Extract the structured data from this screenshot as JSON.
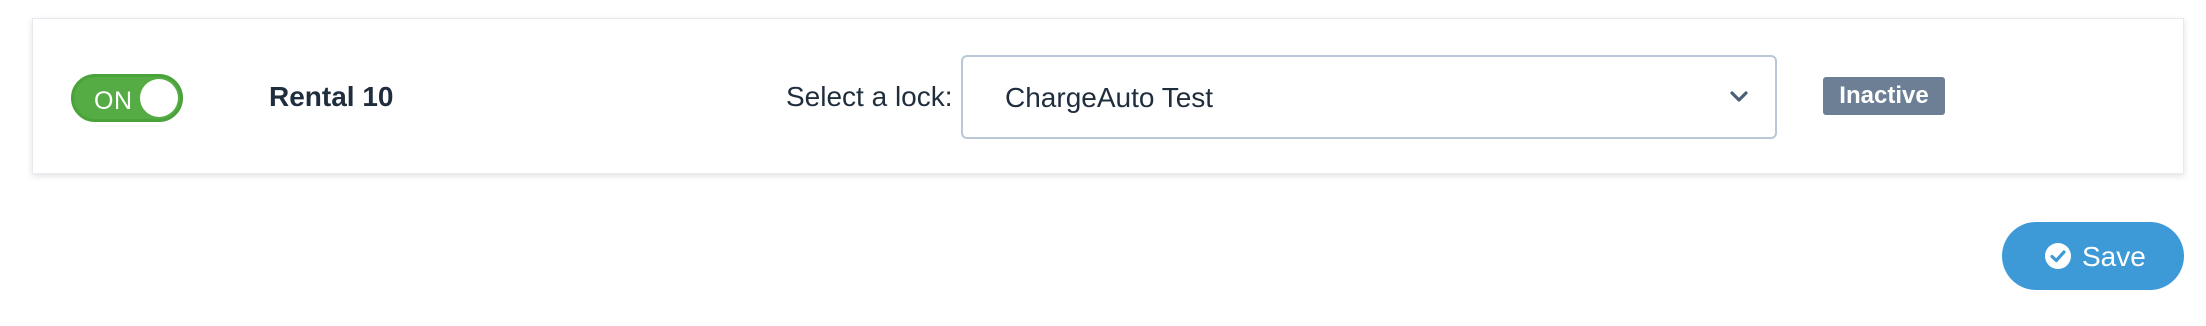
{
  "row": {
    "toggle": {
      "label": "ON",
      "state": "on",
      "color": "#55ac44"
    },
    "rental_name": "Rental 10",
    "lock_select": {
      "label": "Select a lock:",
      "selected": "ChargeAuto Test",
      "icon": "chevron-down-icon"
    },
    "status_badge": {
      "text": "Inactive",
      "color": "#6c7f95"
    }
  },
  "actions": {
    "save": {
      "label": "Save",
      "icon": "check-circle-icon",
      "color": "#3d9ad6"
    }
  }
}
